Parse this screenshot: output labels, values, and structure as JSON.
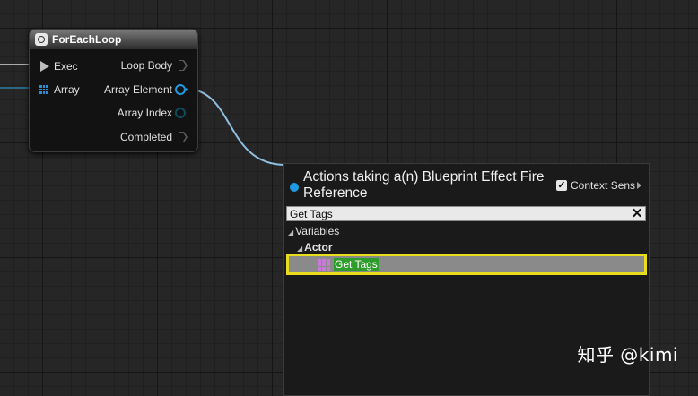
{
  "node": {
    "title": "ForEachLoop",
    "pins": {
      "exec": "Exec",
      "array": "Array",
      "loop_body": "Loop Body",
      "array_element": "Array Element",
      "array_index": "Array Index",
      "completed": "Completed"
    }
  },
  "action_menu": {
    "title": "Actions taking a(n) Blueprint Effect Fire Reference",
    "context_sensitive": {
      "label": "Context Sensitive",
      "checked": true
    },
    "search": {
      "value": "Get Tags",
      "placeholder": ""
    },
    "tree": {
      "category_root": "Variables",
      "category_sub": "Actor",
      "selected_item": "Get Tags"
    }
  },
  "watermark": "知乎 @kimi",
  "colors": {
    "object_pin": "#1e9be0",
    "array_var": "#c77ad6",
    "selection_outline": "#e8dc1c",
    "highlight": "#2e9d2c"
  }
}
